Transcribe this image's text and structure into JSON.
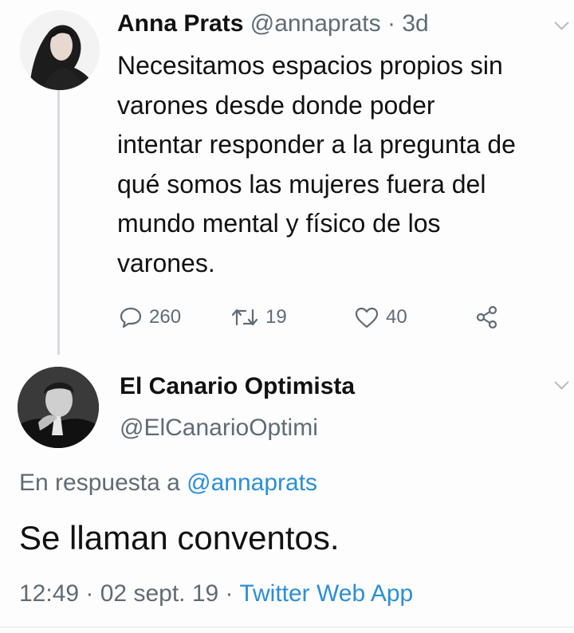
{
  "tweet1": {
    "avatar": "avatar-woman-photo",
    "name": "Anna Prats",
    "handle": "@annaprats",
    "dot": "·",
    "time": "3d",
    "body_lines": [
      "Necesitamos espacios propios sin",
      "varones desde donde poder",
      "intentar responder a la pregunta de",
      "qué somos las mujeres fuera del",
      "mundo mental y físico de los",
      "varones."
    ],
    "actions": {
      "reply": {
        "icon": "reply-icon",
        "count": "260"
      },
      "retweet": {
        "icon": "retweet-icon",
        "count": "19"
      },
      "like": {
        "icon": "heart-icon",
        "count": "40"
      },
      "share": {
        "icon": "share-icon"
      }
    }
  },
  "tweet2": {
    "avatar": "avatar-man-photo",
    "name": "El Canario Optimista",
    "handle": "@ElCanarioOptimi",
    "reply_prefix": "En respuesta a ",
    "reply_mention": "@annaprats",
    "body": "Se llaman conventos.",
    "time": "12:49",
    "sep1": " · ",
    "date": "02 sept. 19",
    "sep2": " · ",
    "source": "Twitter Web App"
  },
  "colors": {
    "text": "#111111",
    "muted": "#5f6b76",
    "link": "#2a8fd6",
    "thread_line": "#d6dbe0"
  }
}
